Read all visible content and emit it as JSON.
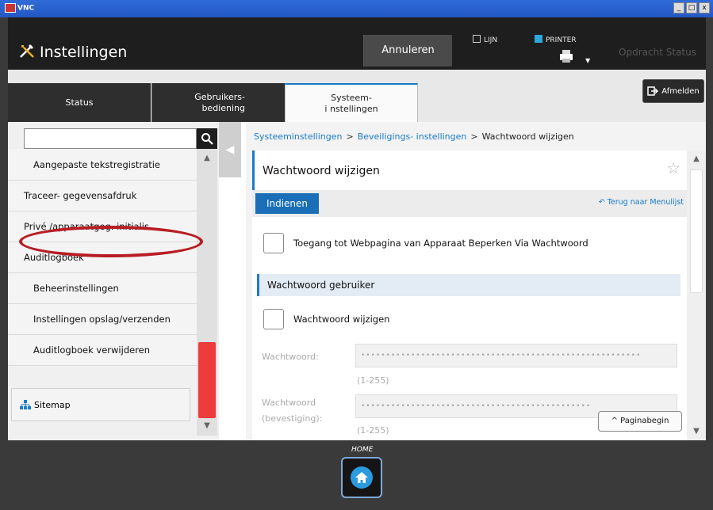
{
  "vnc": {
    "title": "VNC",
    "window_buttons": [
      "_",
      "□",
      "x"
    ]
  },
  "header": {
    "app_title": "Instellingen",
    "cancel_label": "Annuleren",
    "line_label": "LIJN",
    "printer_label": "PRINTER",
    "job_status_label": "Opdracht Status",
    "line_color": "#e8e8e8",
    "printer_color": "#2aa8e0"
  },
  "tabs": [
    {
      "label_line1": "Status",
      "label_line2": "",
      "active": false
    },
    {
      "label_line1": "Gebruikers-",
      "label_line2": "bediening",
      "active": false
    },
    {
      "label_line1": "Systeem-",
      "label_line2": "i nstellingen",
      "active": true
    }
  ],
  "logout_label": "Afmelden",
  "sidebar": {
    "search_placeholder": "",
    "items": [
      {
        "label": "Aangepaste tekstregistratie",
        "indent": 2
      },
      {
        "label": "Traceer- gegevensafdruk",
        "indent": 1
      },
      {
        "label": "Privé /apparaatgeg. initialis.",
        "indent": 1
      },
      {
        "label": "Auditlogboek",
        "indent": 1
      },
      {
        "label": "Beheerinstellingen",
        "indent": 2
      },
      {
        "label": "Instellingen opslag/verzenden",
        "indent": 2
      },
      {
        "label": "Auditlogboek verwijderen",
        "indent": 2
      }
    ],
    "sitemap_label": "Sitemap",
    "accent_color": "#ee3b3b"
  },
  "breadcrumb": {
    "level1": "Systeeminstellingen",
    "level2": "Beveiligings- instellingen",
    "current": "Wachtwoord wijzigen",
    "separator": ">"
  },
  "page": {
    "title": "Wachtwoord wijzigen",
    "submit_label": "Indienen",
    "back_label": "Terug naar Menulijst",
    "restrict_label": "Toegang tot Webpagina van Apparaat Beperken Via Wachtwoord",
    "section_title": "Wachtwoord gebruiker",
    "change_pw_label": "Wachtwoord wijzigen",
    "pw_label": "Wachtwoord:",
    "pw_value": "••••••••••••••••••••••••••••••••••••••••••••••••••••••••",
    "pw_hint": "(1-255)",
    "confirm_label_line1": "Wachtwoord",
    "confirm_label_line2": "(bevestiging):",
    "confirm_value": "••••••••••••••••••••••••••••••••••••••••••••••",
    "confirm_hint": "(1-255)",
    "page_top_label": "Paginabegin"
  },
  "home_label": "HOME",
  "accent": "#1a7bc8",
  "annotation_color": "#b81d24"
}
